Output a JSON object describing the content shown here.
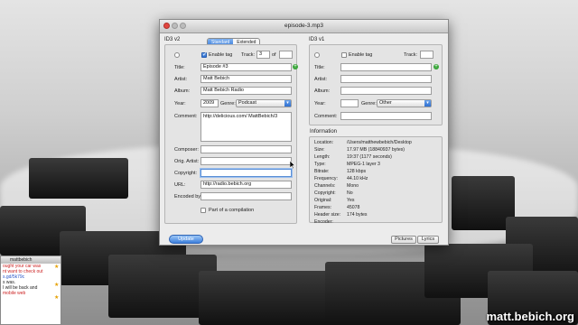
{
  "window": {
    "title": "episode-3.mp3"
  },
  "id3v2": {
    "header": "ID3 v2",
    "tabs": [
      "Standard",
      "Extended"
    ],
    "enable_tag_label": "Enable tag",
    "track_label": "Track:",
    "track_value": "3",
    "track_of_label": "of",
    "title_label": "Title:",
    "title_value": "Episode #3",
    "artist_label": "Artist:",
    "artist_value": "Matt Bebich",
    "album_label": "Album:",
    "album_value": "Matt Bebich Radio",
    "year_label": "Year:",
    "year_value": "2009",
    "genre_label": "Genre:",
    "genre_value": "Podcast",
    "comment_label": "Comment:",
    "comment_value": "http://delicious.com/ MattBebich/3",
    "composer_label": "Composer:",
    "orig_artist_label": "Orig. Artist:",
    "copyright_label": "Copyright:",
    "url_label": "URL:",
    "url_value": "http://radio.bebich.org",
    "encoded_by_label": "Encoded by:",
    "compilation_label": "Part of a compilation"
  },
  "id3v1": {
    "header": "ID3 v1",
    "enable_tag_label": "Enable tag",
    "track_label": "Track:",
    "title_label": "Title:",
    "artist_label": "Artist:",
    "album_label": "Album:",
    "year_label": "Year:",
    "genre_label": "Genre:",
    "genre_value": "Other",
    "comment_label": "Comment:"
  },
  "information": {
    "header": "Information",
    "rows": [
      {
        "k": "Location:",
        "v": "/Users/matthewbebich/Desktop"
      },
      {
        "k": "Size:",
        "v": "17.97 MB (18840937 bytes)"
      },
      {
        "k": "Length:",
        "v": "19:37 (1177 seconds)"
      },
      {
        "k": "Type:",
        "v": "MPEG-1 layer 3"
      },
      {
        "k": "Bitrate:",
        "v": "128 kbps"
      },
      {
        "k": "Frequency:",
        "v": "44.10 kHz"
      },
      {
        "k": "Channels:",
        "v": "Mono"
      },
      {
        "k": "Copyright:",
        "v": "No"
      },
      {
        "k": "Original:",
        "v": "Yes"
      },
      {
        "k": "Frames:",
        "v": "45078"
      },
      {
        "k": "Header size:",
        "v": "174 bytes"
      },
      {
        "k": "Encoder:",
        "v": ""
      }
    ]
  },
  "buttons": {
    "update": "Update",
    "pictures": "Pictures",
    "lyrics": "Lyrics"
  },
  "chat": {
    "title": "mattbebich",
    "lines": [
      {
        "t": "ought your car was",
        "c": "red"
      },
      {
        "t": "nt want to check out",
        "c": "red"
      },
      {
        "t": "s.gd/5k79c",
        "c": "blue"
      },
      {
        "t": "s was.",
        "c": ""
      },
      {
        "t": "",
        "c": ""
      },
      {
        "t": "I will be back and",
        "c": ""
      },
      {
        "t": "",
        "c": ""
      },
      {
        "t": "mobile web",
        "c": "red"
      }
    ]
  },
  "watermark": "matt.bebich.org"
}
